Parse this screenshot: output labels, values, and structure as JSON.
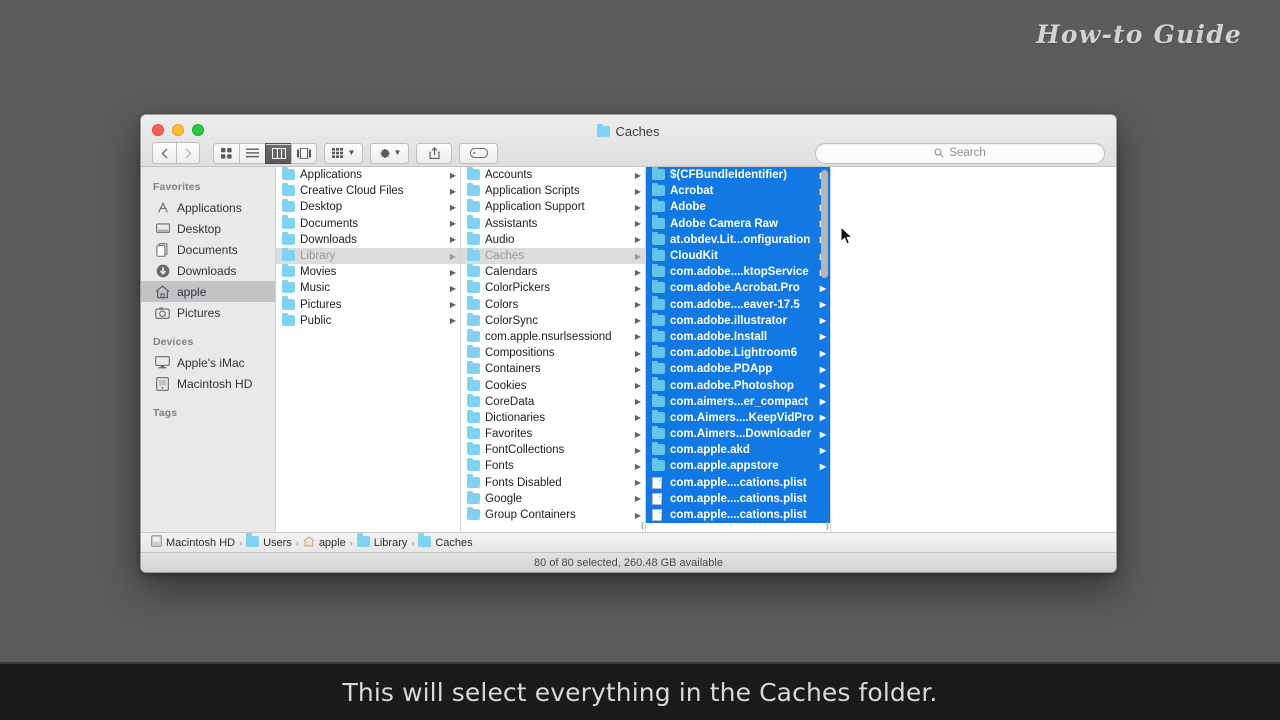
{
  "overlay": {
    "watermark": "How-to Guide",
    "caption": "This will select everything in the Caches folder."
  },
  "window": {
    "title": "Caches",
    "title_icon": "folder-icon",
    "traffic_lights": [
      "close-button",
      "minimize-button",
      "maximize-button"
    ]
  },
  "toolbar": {
    "back_label": "‹",
    "forward_label": "›",
    "view_buttons": [
      {
        "name": "icon-view",
        "label": "icon view"
      },
      {
        "name": "list-view",
        "label": "list view"
      },
      {
        "name": "column-view",
        "label": "column view",
        "active": true
      },
      {
        "name": "coverflow-view",
        "label": "cover flow view"
      }
    ],
    "arrange_label": "Arrange",
    "action_label": "Action",
    "share_label": "Share",
    "tags_label": "Edit Tags"
  },
  "search": {
    "placeholder": "Search",
    "value": "",
    "icon": "search-icon"
  },
  "sidebar": {
    "sections": [
      {
        "header": "Favorites",
        "items": [
          {
            "label": "Applications",
            "icon": "applications-icon",
            "selected": false
          },
          {
            "label": "Desktop",
            "icon": "desktop-icon",
            "selected": false
          },
          {
            "label": "Documents",
            "icon": "documents-icon",
            "selected": false
          },
          {
            "label": "Downloads",
            "icon": "downloads-icon",
            "selected": false
          },
          {
            "label": "apple",
            "icon": "home-icon",
            "selected": true
          },
          {
            "label": "Pictures",
            "icon": "pictures-icon",
            "selected": false
          }
        ]
      },
      {
        "header": "Devices",
        "items": [
          {
            "label": "Apple's iMac",
            "icon": "imac-icon",
            "selected": false
          },
          {
            "label": "Macintosh HD",
            "icon": "harddisk-icon",
            "selected": false
          }
        ]
      },
      {
        "header": "Tags",
        "items": []
      }
    ]
  },
  "columns": [
    {
      "name": "home-column",
      "rows": [
        {
          "label": "Applications",
          "type": "folder",
          "state": "normal"
        },
        {
          "label": "Creative Cloud Files",
          "type": "folder",
          "state": "normal"
        },
        {
          "label": "Desktop",
          "type": "folder",
          "state": "normal"
        },
        {
          "label": "Documents",
          "type": "folder",
          "state": "normal"
        },
        {
          "label": "Downloads",
          "type": "folder",
          "state": "normal"
        },
        {
          "label": "Library",
          "type": "folder",
          "state": "dim-selected"
        },
        {
          "label": "Movies",
          "type": "folder",
          "state": "normal"
        },
        {
          "label": "Music",
          "type": "folder",
          "state": "normal"
        },
        {
          "label": "Pictures",
          "type": "folder",
          "state": "normal"
        },
        {
          "label": "Public",
          "type": "folder",
          "state": "normal"
        }
      ]
    },
    {
      "name": "library-column",
      "rows": [
        {
          "label": "Accounts",
          "type": "folder",
          "state": "normal"
        },
        {
          "label": "Application Scripts",
          "type": "folder",
          "state": "normal"
        },
        {
          "label": "Application Support",
          "type": "folder",
          "state": "normal"
        },
        {
          "label": "Assistants",
          "type": "folder",
          "state": "normal"
        },
        {
          "label": "Audio",
          "type": "folder",
          "state": "normal"
        },
        {
          "label": "Caches",
          "type": "folder",
          "state": "dim-selected"
        },
        {
          "label": "Calendars",
          "type": "folder",
          "state": "normal"
        },
        {
          "label": "ColorPickers",
          "type": "folder",
          "state": "normal"
        },
        {
          "label": "Colors",
          "type": "folder",
          "state": "normal"
        },
        {
          "label": "ColorSync",
          "type": "folder",
          "state": "normal"
        },
        {
          "label": "com.apple.nsurlsessiond",
          "type": "folder",
          "state": "normal"
        },
        {
          "label": "Compositions",
          "type": "folder",
          "state": "normal"
        },
        {
          "label": "Containers",
          "type": "folder",
          "state": "normal"
        },
        {
          "label": "Cookies",
          "type": "folder",
          "state": "normal"
        },
        {
          "label": "CoreData",
          "type": "folder",
          "state": "normal"
        },
        {
          "label": "Dictionaries",
          "type": "folder",
          "state": "normal"
        },
        {
          "label": "Favorites",
          "type": "folder",
          "state": "normal"
        },
        {
          "label": "FontCollections",
          "type": "folder",
          "state": "normal"
        },
        {
          "label": "Fonts",
          "type": "folder",
          "state": "normal"
        },
        {
          "label": "Fonts Disabled",
          "type": "folder",
          "state": "normal"
        },
        {
          "label": "Google",
          "type": "folder",
          "state": "normal"
        },
        {
          "label": "Group Containers",
          "type": "folder",
          "state": "normal"
        }
      ]
    },
    {
      "name": "caches-column",
      "rows": [
        {
          "label": "$(CFBundleIdentifier)",
          "type": "folder",
          "state": "selected"
        },
        {
          "label": "Acrobat",
          "type": "folder",
          "state": "selected"
        },
        {
          "label": "Adobe",
          "type": "folder",
          "state": "selected"
        },
        {
          "label": "Adobe Camera Raw",
          "type": "folder",
          "state": "selected"
        },
        {
          "label": "at.obdev.Lit...onfiguration",
          "type": "folder",
          "state": "selected"
        },
        {
          "label": "CloudKit",
          "type": "folder",
          "state": "selected"
        },
        {
          "label": "com.adobe....ktopService",
          "type": "folder",
          "state": "selected"
        },
        {
          "label": "com.adobe.Acrobat.Pro",
          "type": "folder",
          "state": "selected"
        },
        {
          "label": "com.adobe....eaver-17.5",
          "type": "folder",
          "state": "selected"
        },
        {
          "label": "com.adobe.illustrator",
          "type": "folder",
          "state": "selected"
        },
        {
          "label": "com.adobe.Install",
          "type": "folder",
          "state": "selected"
        },
        {
          "label": "com.adobe.Lightroom6",
          "type": "folder",
          "state": "selected"
        },
        {
          "label": "com.adobe.PDApp",
          "type": "folder",
          "state": "selected"
        },
        {
          "label": "com.adobe.Photoshop",
          "type": "folder",
          "state": "selected"
        },
        {
          "label": "com.aimers...er_compact",
          "type": "folder",
          "state": "selected"
        },
        {
          "label": "com.Aimers....KeepVidPro",
          "type": "folder",
          "state": "selected"
        },
        {
          "label": "com.Aimers...Downloader",
          "type": "folder",
          "state": "selected"
        },
        {
          "label": "com.apple.akd",
          "type": "folder",
          "state": "selected"
        },
        {
          "label": "com.apple.appstore",
          "type": "folder",
          "state": "selected"
        },
        {
          "label": "com.apple....cations.plist",
          "type": "file",
          "state": "selected"
        },
        {
          "label": "com.apple....cations.plist",
          "type": "file",
          "state": "selected"
        },
        {
          "label": "com.apple....cations.plist",
          "type": "file",
          "state": "selected"
        }
      ]
    },
    {
      "name": "preview-column",
      "rows": []
    }
  ],
  "path_bar": {
    "crumbs": [
      {
        "label": "Macintosh HD",
        "icon": "harddisk-icon"
      },
      {
        "label": "Users",
        "icon": "folder-icon"
      },
      {
        "label": "apple",
        "icon": "home-icon"
      },
      {
        "label": "Library",
        "icon": "folder-icon"
      },
      {
        "label": "Caches",
        "icon": "folder-icon"
      }
    ],
    "separator": "›"
  },
  "status_bar": {
    "text": "80 of 80 selected, 260.48 GB available"
  },
  "colors": {
    "selection_blue": "#1278e4",
    "folder_blue": "#7fd3f2",
    "desktop_gray": "#5c5c5c",
    "caption_bg": "#1a1a1a"
  }
}
